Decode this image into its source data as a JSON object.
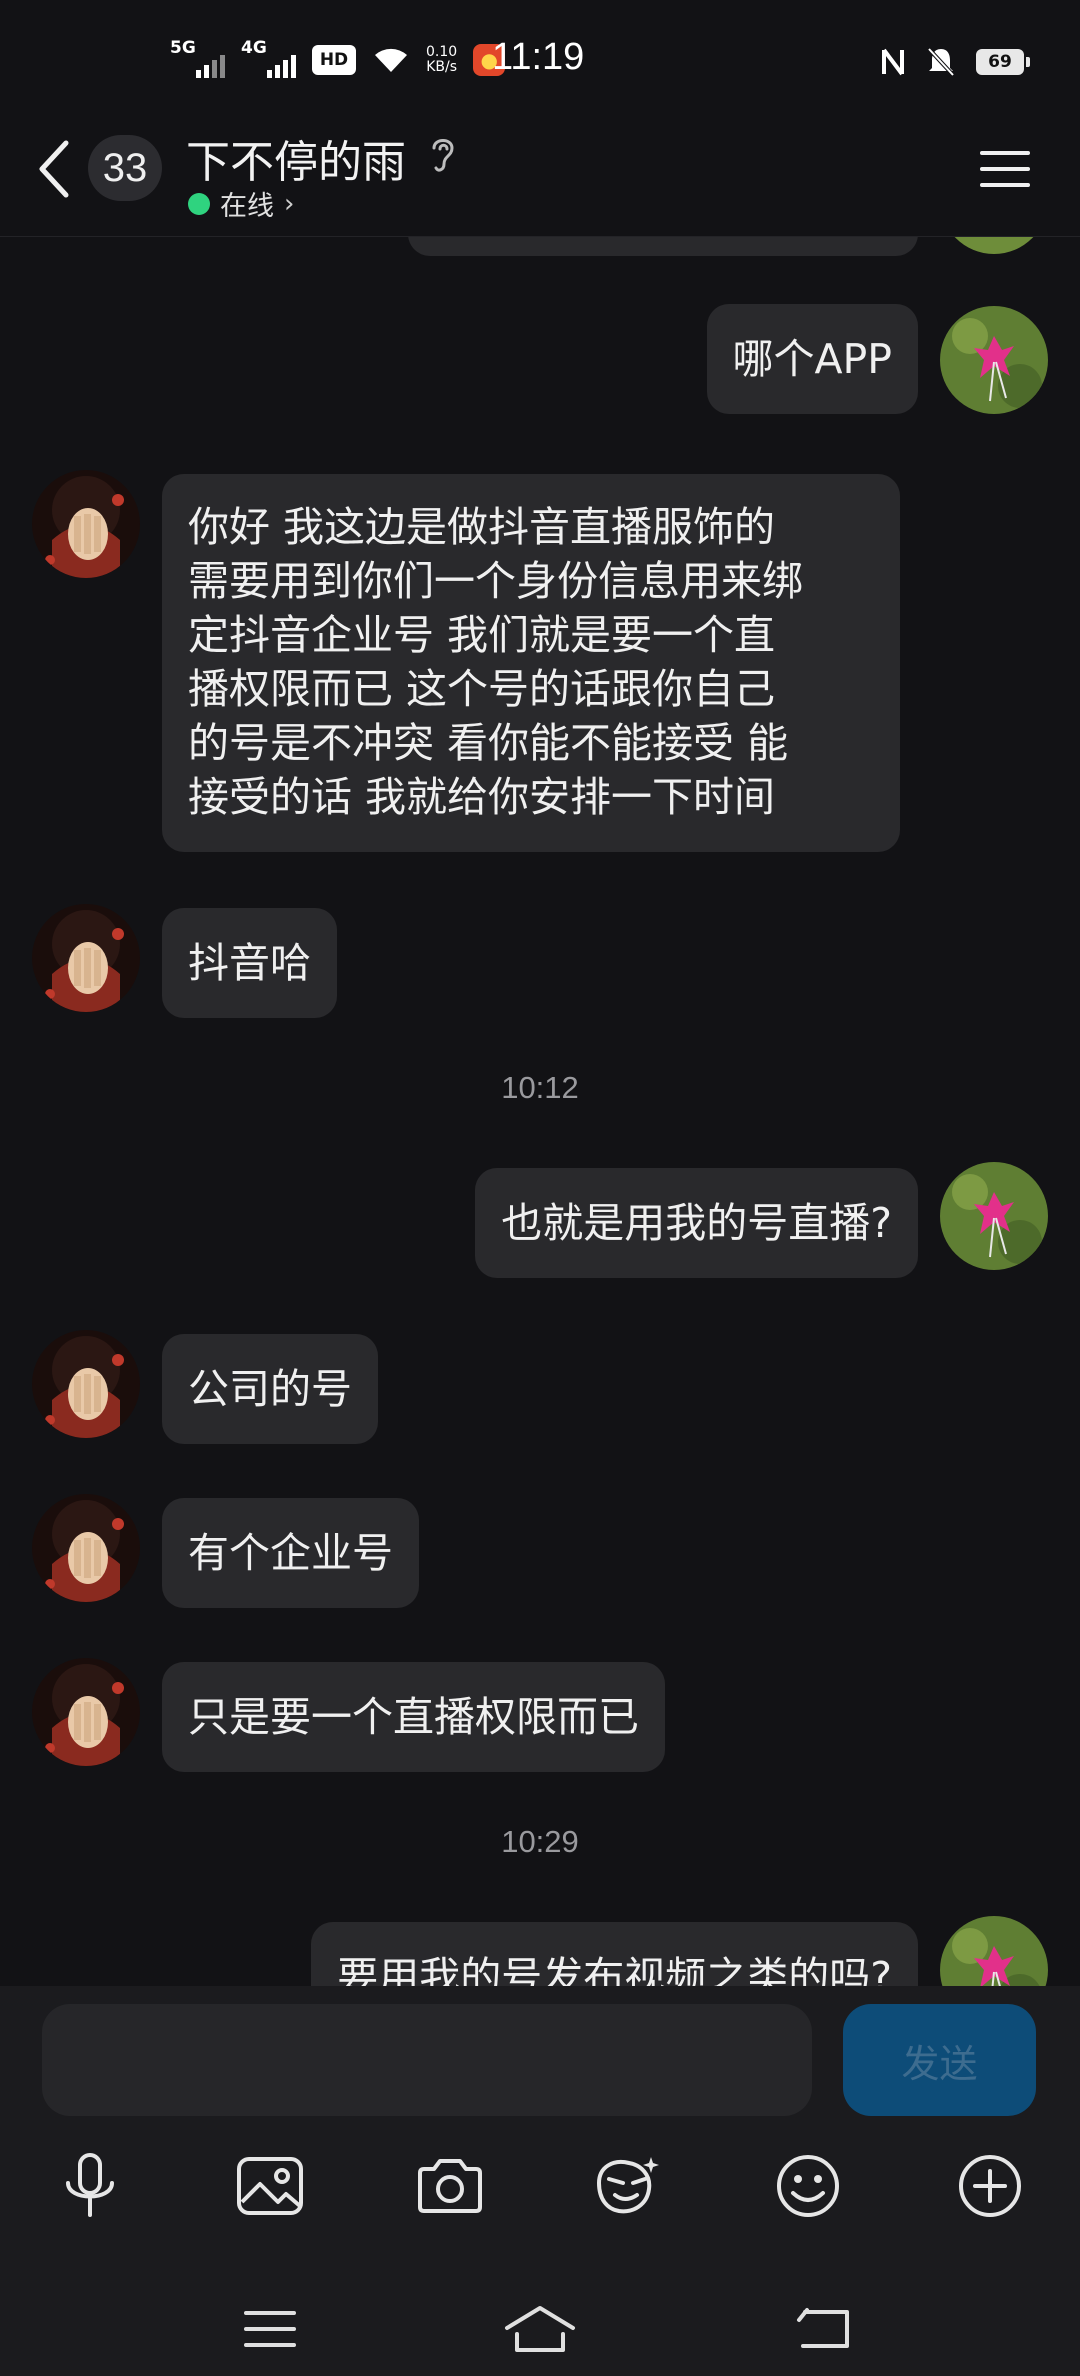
{
  "status_bar": {
    "net1": "5G",
    "net2": "4G",
    "hd": "HD",
    "speed_value": "0.10",
    "speed_unit": "KB/s",
    "time": "11:19",
    "battery": "69"
  },
  "header": {
    "unread_count": "33",
    "contact_name": "下不停的雨",
    "status": "在线",
    "status_color": "#2fd37f"
  },
  "messages": [
    {
      "sender": "self",
      "text": "哪个APP"
    },
    {
      "sender": "other",
      "text": "你好 我这边是做抖音直播服饰的\n需要用到你们一个身份信息用来绑\n定抖音企业号 我们就是要一个直\n播权限而已 这个号的话跟你自己\n的号是不冲突 看你能不能接受 能\n接受的话 我就给你安排一下时间"
    },
    {
      "sender": "other",
      "text": "抖音哈"
    },
    {
      "type": "time",
      "text": "10:12"
    },
    {
      "sender": "self",
      "text": "也就是用我的号直播?"
    },
    {
      "sender": "other",
      "text": "公司的号"
    },
    {
      "sender": "other",
      "text": "有个企业号"
    },
    {
      "sender": "other",
      "text": "只是要一个直播权限而已"
    },
    {
      "type": "time",
      "text": "10:29"
    },
    {
      "sender": "self",
      "text": "要用我的号发布视频之类的吗?"
    }
  ],
  "input": {
    "value": "",
    "send_label": "发送"
  },
  "toolbar": {
    "items": [
      "mic-icon",
      "image-icon",
      "camera-icon",
      "sticker-icon",
      "emoji-icon",
      "plus-icon"
    ]
  },
  "colors": {
    "background": "#121215",
    "bubble": "#29292c",
    "send_button": "#0d4c78"
  }
}
